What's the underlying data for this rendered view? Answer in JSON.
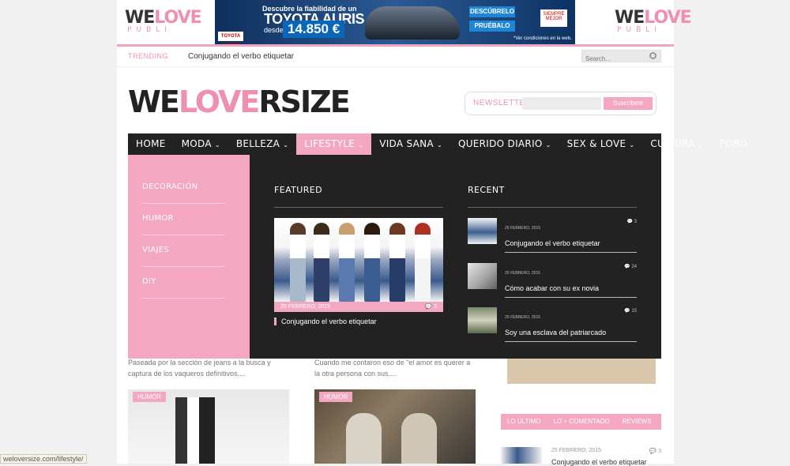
{
  "ads": {
    "left_publi": {
      "brand_a": "WE",
      "brand_b": "LOVE",
      "sub": "PUBLI"
    },
    "right_publi": {
      "brand_a": "WE",
      "brand_b": "LOVE",
      "sub": "PUBLI"
    },
    "banner": {
      "line1": "Descubre la fiabilidad de un",
      "line2": "TOYOTA AURIS",
      "desde": "desde",
      "price": "14.850 €",
      "btn1": "DESCÚBRELO",
      "btn2": "PRUÉBALO",
      "toyota": "TOYOTA HYBRID",
      "siempre": "SIEMPRE MEJOR",
      "cond": "*Ver condiciones en la web."
    }
  },
  "trending": {
    "label": "TRENDING",
    "text": "Conjugando el verbo etiquetar"
  },
  "search": {
    "placeholder": "Search..."
  },
  "logo": {
    "part1": "WE",
    "part2": "LOVE",
    "part3": "RSIZE"
  },
  "newsletter": {
    "label": "NEWSLETTER",
    "button": "Suscríbete"
  },
  "nav": [
    {
      "label": "HOME",
      "chev": ""
    },
    {
      "label": "MODA",
      "chev": "⌄"
    },
    {
      "label": "BELLEZA",
      "chev": "⌄"
    },
    {
      "label": "LIFESTYLE",
      "chev": "⌄"
    },
    {
      "label": "VIDA SANA",
      "chev": "⌄"
    },
    {
      "label": "QUERIDO DIARIO",
      "chev": "⌄"
    },
    {
      "label": "SEX & LOVE",
      "chev": "⌄"
    },
    {
      "label": "CULTURA",
      "chev": "⌄"
    },
    {
      "label": "FORO",
      "chev": ""
    }
  ],
  "mega": {
    "categories": [
      "DECORACIÓN",
      "HUMOR",
      "VIAJES",
      "DIY"
    ],
    "featured_heading": "FEATURED",
    "recent_heading": "RECENT",
    "featured": {
      "date": "25 FEBRERO, 2015",
      "comments": "3",
      "title": "Conjugando el verbo etiquetar"
    },
    "recent": [
      {
        "date": "25 FEBRERO, 2015",
        "comments": "3",
        "title": "Conjugando el verbo etiquetar"
      },
      {
        "date": "25 FEBRERO, 2015",
        "comments": "24",
        "title": "Cómo acabar con su ex novia"
      },
      {
        "date": "25 FEBRERO, 2015",
        "comments": "15",
        "title": "Soy una esclava del patriarcado"
      }
    ]
  },
  "snippets": {
    "left": "Paseada por la sección de jeans a la busca y captura de los vaqueros definitivos....",
    "right": "Cuando me contaron eso de \"el amor es querer a la otra persona con sus...."
  },
  "cards": [
    {
      "label": "HUMOR"
    },
    {
      "label": "HUMOR"
    }
  ],
  "sidebar_tabs": [
    "LO ÚLTIMO",
    "LO + COMENTADO",
    "REVIEWS"
  ],
  "side_post": {
    "date": "25 FEBRERO, 2015",
    "comments": "3",
    "title": "Conjugando el verbo etiquetar"
  },
  "status_url": "weloversize.com/lifestyle/",
  "colors": {
    "pink": "#f4a7c1",
    "dark": "#222222"
  }
}
